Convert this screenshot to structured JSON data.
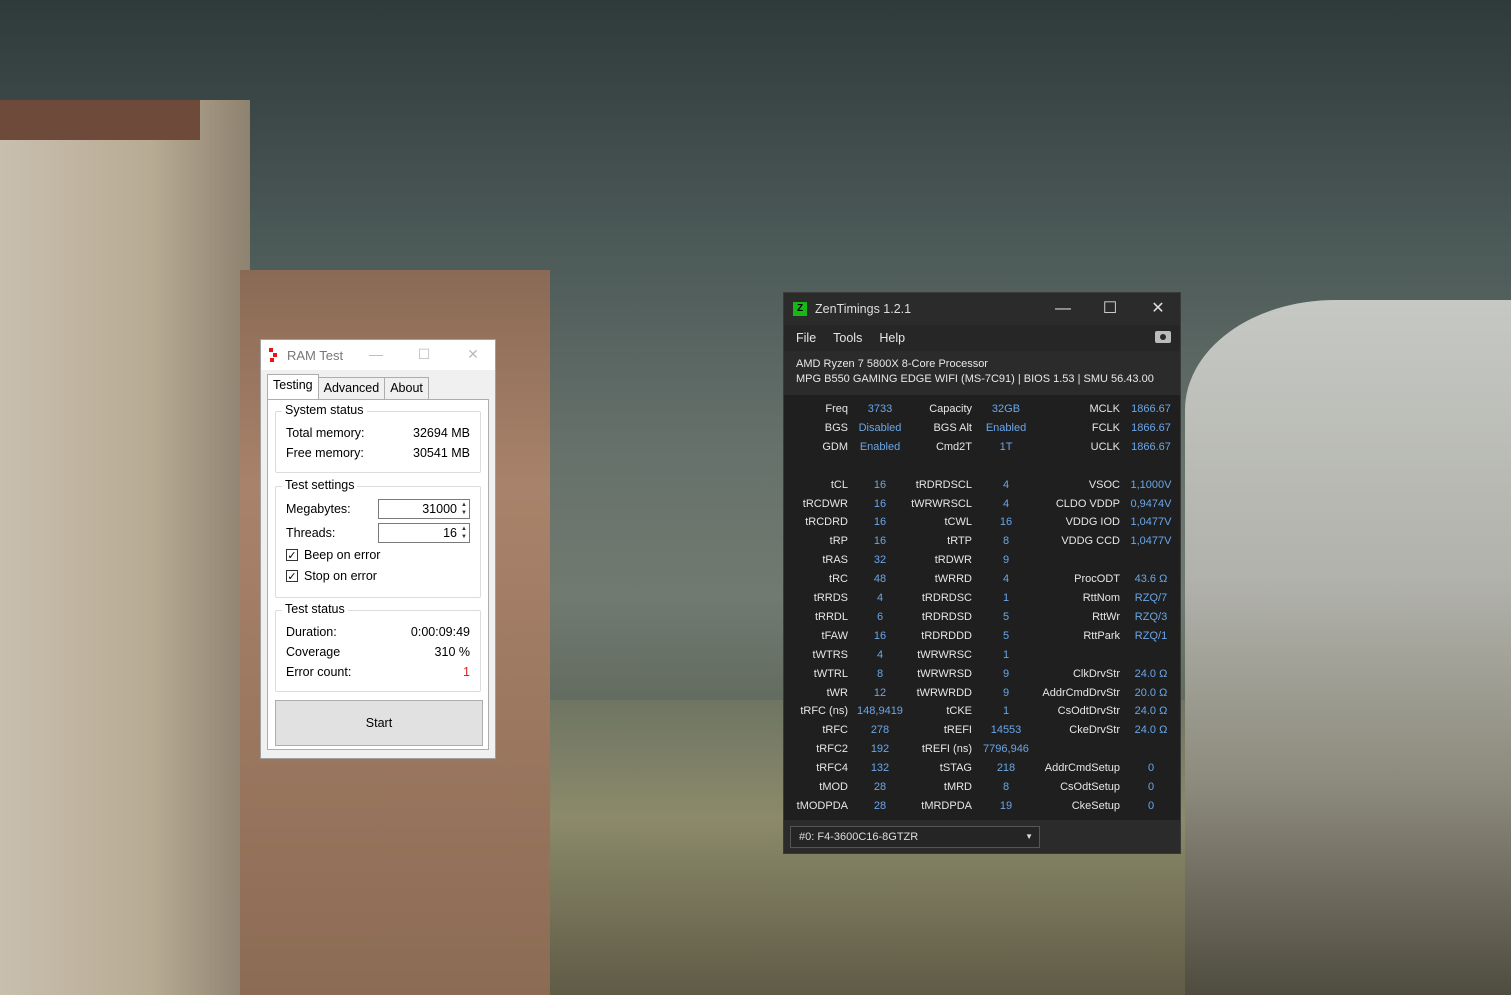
{
  "ramtest": {
    "title": "RAM Test",
    "controls": {
      "minimize": "—",
      "maximize": "☐",
      "close": "✕"
    },
    "tabs": [
      "Testing",
      "Advanced",
      "About"
    ],
    "system_status": {
      "title": "System status",
      "total_label": "Total memory:",
      "total_value": "32694 MB",
      "free_label": "Free memory:",
      "free_value": "30541 MB"
    },
    "test_settings": {
      "title": "Test settings",
      "megabytes_label": "Megabytes:",
      "megabytes_value": "31000",
      "threads_label": "Threads:",
      "threads_value": "16",
      "beep_label": "Beep on error",
      "beep_checked": true,
      "stop_label": "Stop on error",
      "stop_checked": true
    },
    "test_status": {
      "title": "Test status",
      "duration_label": "Duration:",
      "duration_value": "0:00:09:49",
      "coverage_label": "Coverage",
      "coverage_value": "310 %",
      "errors_label": "Error count:",
      "errors_value": "1",
      "error_color": "#e02020"
    },
    "start_label": "Start"
  },
  "zen": {
    "title": "ZenTimings 1.2.1",
    "logo": "Z",
    "controls": {
      "minimize": "—",
      "maximize": "☐",
      "close": "✕"
    },
    "menu": [
      "File",
      "Tools",
      "Help"
    ],
    "cpu": "AMD Ryzen 7 5800X 8-Core Processor",
    "board": "MPG B550 GAMING EDGE WIFI (MS-7C91) | BIOS 1.53 | SMU 56.43.00",
    "value_color": "#6aa6e8",
    "rows": [
      [
        "Freq",
        "3733",
        "Capacity",
        "32GB",
        "MCLK",
        "1866.67"
      ],
      [
        "BGS",
        "Disabled",
        "BGS Alt",
        "Enabled",
        "FCLK",
        "1866.67"
      ],
      [
        "GDM",
        "Enabled",
        "Cmd2T",
        "1T",
        "UCLK",
        "1866.67"
      ],
      [
        "",
        "",
        "",
        "",
        "",
        ""
      ],
      [
        "tCL",
        "16",
        "tRDRDSCL",
        "4",
        "VSOC",
        "1,1000V"
      ],
      [
        "tRCDWR",
        "16",
        "tWRWRSCL",
        "4",
        "CLDO VDDP",
        "0,9474V"
      ],
      [
        "tRCDRD",
        "16",
        "tCWL",
        "16",
        "VDDG IOD",
        "1,0477V"
      ],
      [
        "tRP",
        "16",
        "tRTP",
        "8",
        "VDDG CCD",
        "1,0477V"
      ],
      [
        "tRAS",
        "32",
        "tRDWR",
        "9",
        "",
        ""
      ],
      [
        "tRC",
        "48",
        "tWRRD",
        "4",
        "ProcODT",
        "43.6 Ω"
      ],
      [
        "tRRDS",
        "4",
        "tRDRDSC",
        "1",
        "RttNom",
        "RZQ/7"
      ],
      [
        "tRRDL",
        "6",
        "tRDRDSD",
        "5",
        "RttWr",
        "RZQ/3"
      ],
      [
        "tFAW",
        "16",
        "tRDRDDD",
        "5",
        "RttPark",
        "RZQ/1"
      ],
      [
        "tWTRS",
        "4",
        "tWRWRSC",
        "1",
        "",
        ""
      ],
      [
        "tWTRL",
        "8",
        "tWRWRSD",
        "9",
        "ClkDrvStr",
        "24.0 Ω"
      ],
      [
        "tWR",
        "12",
        "tWRWRDD",
        "9",
        "AddrCmdDrvStr",
        "20.0 Ω"
      ],
      [
        "tRFC (ns)",
        "148,9419",
        "tCKE",
        "1",
        "CsOdtDrvStr",
        "24.0 Ω"
      ],
      [
        "tRFC",
        "278",
        "tREFI",
        "14553",
        "CkeDrvStr",
        "24.0 Ω"
      ],
      [
        "tRFC2",
        "192",
        "tREFI (ns)",
        "7796,946",
        "",
        ""
      ],
      [
        "tRFC4",
        "132",
        "tSTAG",
        "218",
        "AddrCmdSetup",
        "0"
      ],
      [
        "tMOD",
        "28",
        "tMRD",
        "8",
        "CsOdtSetup",
        "0"
      ],
      [
        "tMODPDA",
        "28",
        "tMRDPDA",
        "19",
        "CkeSetup",
        "0"
      ]
    ],
    "dimm_select": "#0: F4-3600C16-8GTZR"
  }
}
